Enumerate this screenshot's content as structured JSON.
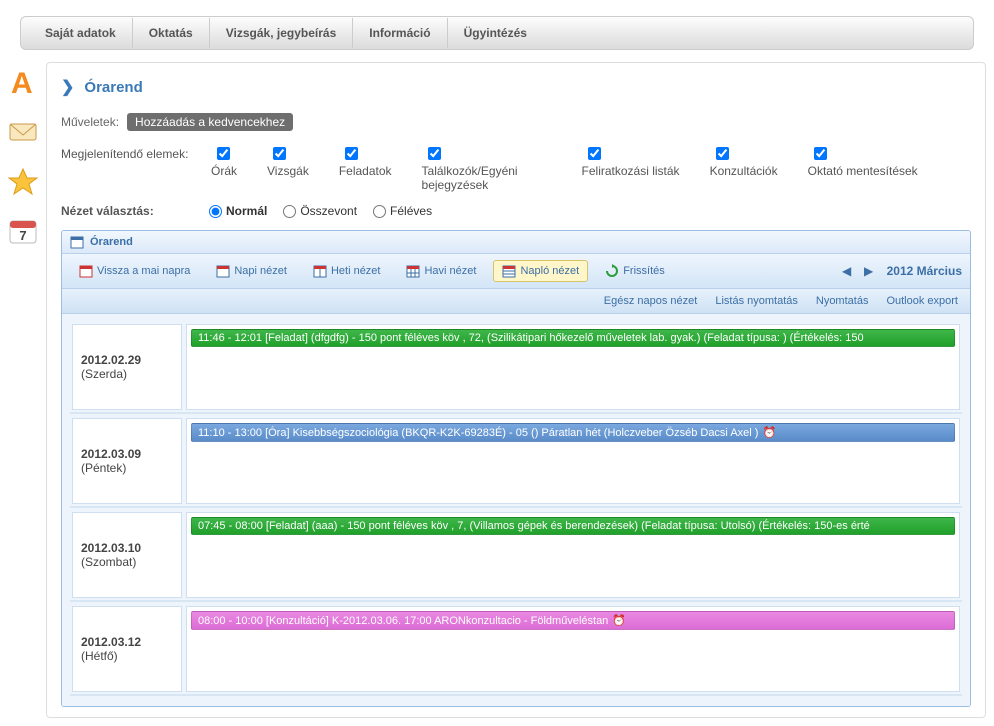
{
  "nav": [
    "Saját adatok",
    "Oktatás",
    "Vizsgák, jegybeírás",
    "Információ",
    "Ügyintézés"
  ],
  "sideIcons": [
    "letter-a-icon",
    "mail-icon",
    "star-icon",
    "calendar-day-icon"
  ],
  "sideCalDay": "7",
  "page": {
    "title": "Órarend"
  },
  "ops": {
    "label": "Műveletek:",
    "favBtn": "Hozzáadás a kedvencekhez"
  },
  "filters": {
    "label": "Megjelenítendő elemek:",
    "items": [
      {
        "label": "Órák"
      },
      {
        "label": "Vizsgák"
      },
      {
        "label": "Feladatok"
      },
      {
        "label": "Találkozók/Egyéni bejegyzések"
      },
      {
        "label": "Feliratkozási listák"
      },
      {
        "label": "Konzultációk"
      },
      {
        "label": "Oktató mentesítések"
      }
    ]
  },
  "view": {
    "label": "Nézet választás:",
    "opts": [
      "Normál",
      "Összevont",
      "Féléves"
    ]
  },
  "cal": {
    "boxTitle": "Órarend",
    "buttons": {
      "today": "Vissza a mai napra",
      "day": "Napi nézet",
      "week": "Heti nézet",
      "month": "Havi nézet",
      "diary": "Napló nézet",
      "refresh": "Frissítés"
    },
    "period": "2012 Március",
    "sub": {
      "allday": "Egész napos nézet",
      "printList": "Listás nyomtatás",
      "print": "Nyomtatás",
      "outlook": "Outlook export"
    }
  },
  "days": [
    {
      "date": "2012.02.29",
      "weekday": "(Szerda)",
      "events": [
        {
          "cls": "evt-green",
          "text": "11:46 - 12:01 [Feladat] (dfgdfg) - 150 pont féléves köv , 72, (Szilikátipari hőkezelő műveletek lab. gyak.) (Feladat típusa: ) (Értékelés: 150"
        }
      ]
    },
    {
      "date": "2012.03.09",
      "weekday": "(Péntek)",
      "events": [
        {
          "cls": "evt-blue",
          "text": "11:10 - 13:00 [Óra] Kisebbségszociológia (BKQR-K2K-69283É) - 05 () Páratlan hét (Holczveber Özséb Dacsi Axel )",
          "clock": true
        }
      ]
    },
    {
      "date": "2012.03.10",
      "weekday": "(Szombat)",
      "events": [
        {
          "cls": "evt-green",
          "text": "07:45 - 08:00 [Feladat] (aaa) - 150 pont féléves köv , 7, (Villamos gépek és berendezések) (Feladat típusa: Utolsó) (Értékelés: 150-es érté"
        }
      ]
    },
    {
      "date": "2012.03.12",
      "weekday": "(Hétfő)",
      "events": [
        {
          "cls": "evt-pink",
          "text": "08:00 - 10:00 [Konzultáció] K-2012.03.06. 17:00 ARONkonzultacio - Földműveléstan",
          "clock": true
        }
      ]
    }
  ]
}
